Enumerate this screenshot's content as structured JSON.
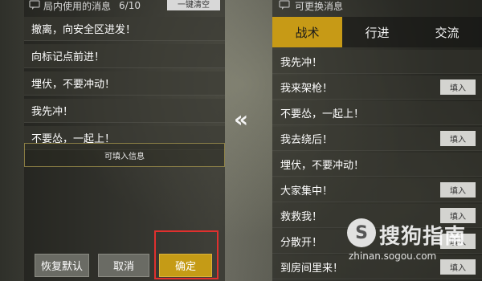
{
  "left": {
    "title": "局内使用的消息",
    "count": "6/10",
    "clear_all": "一键清空",
    "messages": [
      "撤离，向安全区进发！",
      "向标记点前进！",
      "埋伏，不要冲动！",
      "我先冲！",
      "不要怂，一起上！"
    ],
    "fill_info": "可填入信息"
  },
  "buttons": {
    "restore": "恢复默认",
    "cancel": "取消",
    "confirm": "确定"
  },
  "collapse": "«",
  "right": {
    "title": "可更换消息",
    "tabs": [
      "战术",
      "行进",
      "交流"
    ],
    "active_tab": "战术",
    "fill_label": "填入",
    "phrases": [
      {
        "text": "我先冲！",
        "has_fill": false
      },
      {
        "text": "我来架枪！",
        "has_fill": true
      },
      {
        "text": "不要怂，一起上！",
        "has_fill": false
      },
      {
        "text": "我去绕后！",
        "has_fill": true
      },
      {
        "text": "埋伏，不要冲动！",
        "has_fill": false
      },
      {
        "text": "大家集中！",
        "has_fill": true
      },
      {
        "text": "救救我！",
        "has_fill": true
      },
      {
        "text": "分散开！",
        "has_fill": true
      },
      {
        "text": "到房间里来！",
        "has_fill": true
      }
    ]
  },
  "watermark": {
    "logo": "S",
    "text": "搜狗指南",
    "domain": "zhinan.sogou.com"
  },
  "colors": {
    "accent": "#c79a16",
    "highlight": "#e0302e"
  }
}
